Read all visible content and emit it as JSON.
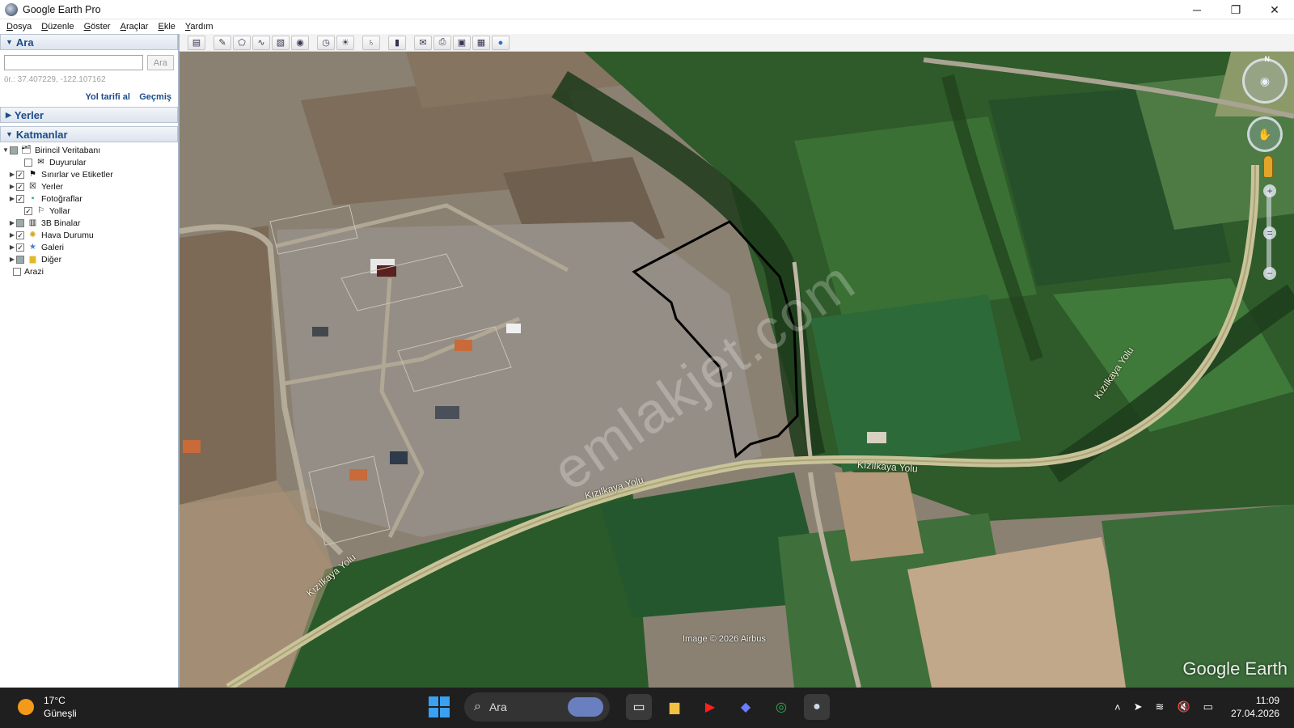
{
  "window": {
    "title": "Google Earth Pro",
    "controls": {
      "minimize": "─",
      "restore": "❐",
      "close": "✕"
    }
  },
  "menu": [
    "Dosya",
    "Düzenle",
    "Göster",
    "Araçlar",
    "Ekle",
    "Yardım"
  ],
  "search": {
    "header": "Ara",
    "placeholder": "",
    "button_label": "Ara",
    "hint": "ör.: 37.407229, -122.107162",
    "directions_link": "Yol tarifi al",
    "history_link": "Geçmiş"
  },
  "places": {
    "header": "Yerler"
  },
  "layers": {
    "header": "Katmanlar",
    "items": [
      {
        "label": "Birincil Veritabanı",
        "checked": "partial",
        "icon": "globe-layers-icon",
        "expandable": true
      },
      {
        "label": "Duyurular",
        "checked": false,
        "icon": "envelope-icon",
        "expandable": false
      },
      {
        "label": "Sınırlar ve Etiketler",
        "checked": true,
        "icon": "flag-icon",
        "expandable": true
      },
      {
        "label": "Yerler",
        "checked": true,
        "icon": "places-icon",
        "expandable": true
      },
      {
        "label": "Fotoğraflar",
        "checked": true,
        "icon": "photo-icon",
        "expandable": true
      },
      {
        "label": "Yollar",
        "checked": true,
        "icon": "road-icon",
        "expandable": false
      },
      {
        "label": "3B Binalar",
        "checked": "partial",
        "icon": "buildings-icon",
        "expandable": true
      },
      {
        "label": "Hava Durumu",
        "checked": true,
        "icon": "weather-icon",
        "expandable": true
      },
      {
        "label": "Galeri",
        "checked": true,
        "icon": "gallery-star-icon",
        "expandable": true
      },
      {
        "label": "Diğer",
        "checked": "partial",
        "icon": "folder-icon",
        "expandable": true
      },
      {
        "label": "Arazi",
        "checked": false,
        "icon": "",
        "expandable": false
      }
    ]
  },
  "toolbar": {
    "buttons": [
      "sidebar-toggle-icon",
      "placemark-icon",
      "polygon-icon",
      "path-icon",
      "image-overlay-icon",
      "record-tour-icon",
      "historical-imagery-icon",
      "sunlight-icon",
      "planets-icon",
      "ruler-icon",
      "email-icon",
      "print-icon",
      "save-image-icon",
      "view-in-maps-icon",
      "earth-icon"
    ]
  },
  "map": {
    "watermark": "emlakjet.com",
    "road_labels": [
      "Kızılkaya Yolu",
      "Kızılkaya Yolu",
      "Kızılkaya Yolu",
      "Kızılkaya Yolu"
    ],
    "attribution": "Image © 2026 Airbus",
    "logo": "Google Earth",
    "compass_north": "N"
  },
  "taskbar": {
    "weather_temp": "17°C",
    "weather_desc": "Güneşli",
    "search_label": "Ara",
    "time": "11:09",
    "date": "27.04.2026"
  }
}
